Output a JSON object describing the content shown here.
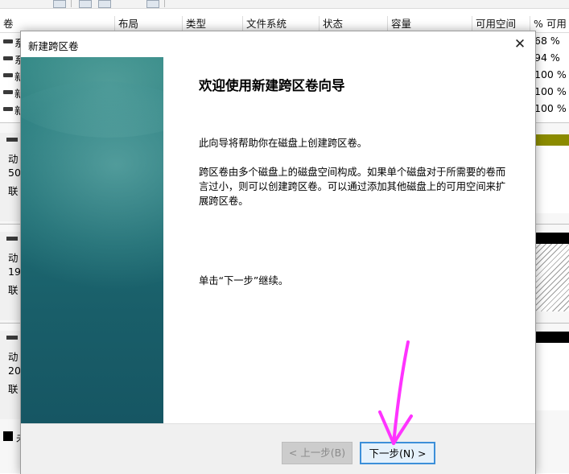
{
  "background": {
    "columns": [
      "卷",
      "布局",
      "类型",
      "文件系统",
      "状态",
      "容量",
      "可用空间",
      "% 可用"
    ],
    "volumes": [
      {
        "name": "系",
        "pct": "68 %"
      },
      {
        "name": "系",
        "pct": "94 %"
      },
      {
        "name": "新",
        "pct": "100 %"
      },
      {
        "name": "新",
        "pct": "100 %"
      },
      {
        "name": "新",
        "pct": "100 %"
      }
    ],
    "disks": [
      {
        "line1": "动",
        "line2": "50",
        "line3": "联"
      },
      {
        "line1": "动",
        "line2": "19",
        "line3": "联"
      },
      {
        "line1": "动",
        "line2": "20",
        "line3": "联"
      }
    ],
    "bottom_label": "未"
  },
  "dialog": {
    "title": "新建跨区卷",
    "close_glyph": "✕",
    "heading": "欢迎使用新建跨区卷向导",
    "para1": "此向导将帮助你在磁盘上创建跨区卷。",
    "para2": "跨区卷由多个磁盘上的磁盘空间构成。如果单个磁盘对于所需要的卷而言过小，则可以创建跨区卷。可以通过添加其他磁盘上的可用空间来扩展跨区卷。",
    "para3": "单击“下一步”继续。",
    "back_label": "< 上一步(B)",
    "next_label": "下一步(N) >"
  },
  "colors": {
    "banner_teal": "#1f6e74",
    "next_border": "#3c8fd9",
    "annotation_arrow": "#ff33ff",
    "disk_bar_olive": "#8b8b00"
  }
}
